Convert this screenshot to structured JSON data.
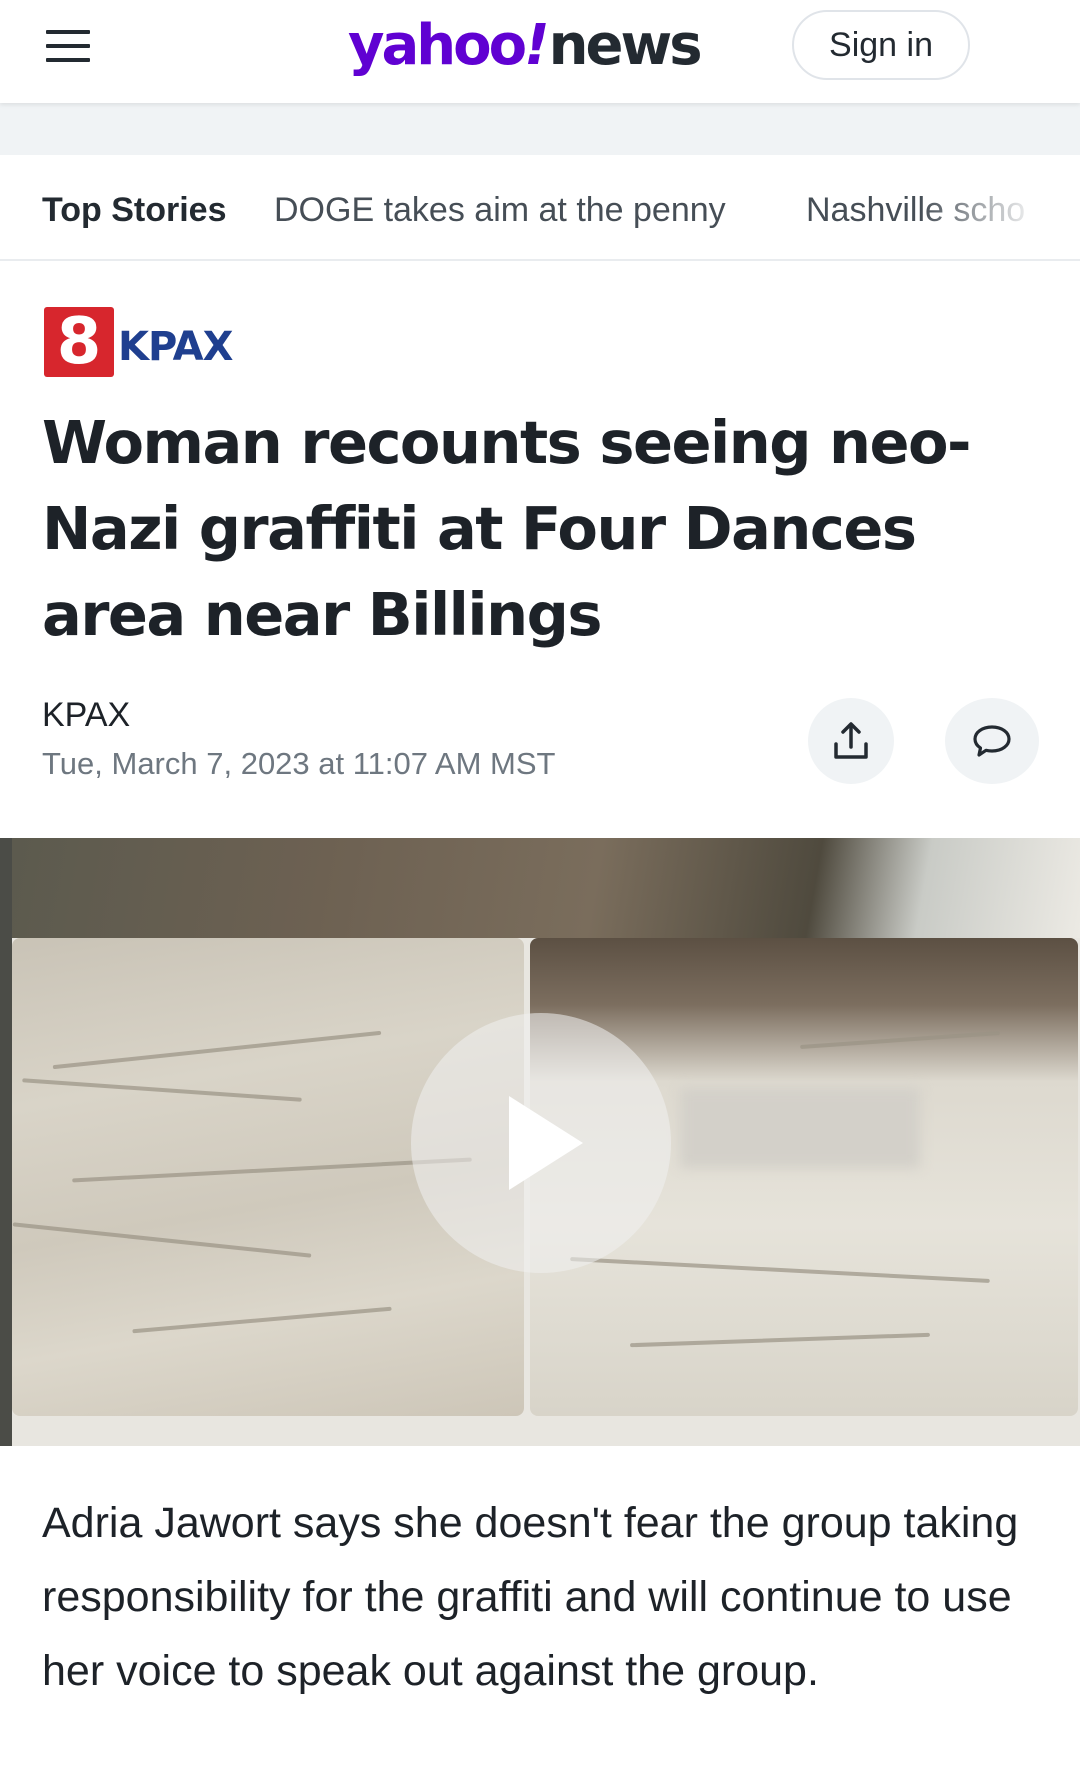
{
  "header": {
    "logo_yahoo": "yahoo",
    "logo_bang": "!",
    "logo_news": "news",
    "signin_label": "Sign in",
    "menu_icon": "hamburger-menu-icon"
  },
  "tabs": [
    {
      "label": "Top Stories",
      "active": true
    },
    {
      "label": "DOGE takes aim at the penny",
      "active": false
    },
    {
      "label": "Nashville scho",
      "active": false
    }
  ],
  "article": {
    "provider_number": "8",
    "provider_name": "KPAX",
    "headline": "Woman recounts seeing neo-Nazi graffiti at Four Dances area near Billings",
    "author": "KPAX",
    "timestamp": "Tue, March 7, 2023 at 11:07 AM MST",
    "share_icon": "share-icon",
    "comment_icon": "comment-icon",
    "video_play_icon": "play-icon",
    "summary": "Adria Jawort says she doesn't fear the group taking responsibility for the graffiti and will continue to use her voice to speak out against the group."
  },
  "colors": {
    "brand_purple": "#6001d2",
    "text_primary": "#1d2228",
    "text_secondary": "#6e7780",
    "kpax_red": "#d7262d",
    "kpax_blue": "#1f3f8f"
  }
}
